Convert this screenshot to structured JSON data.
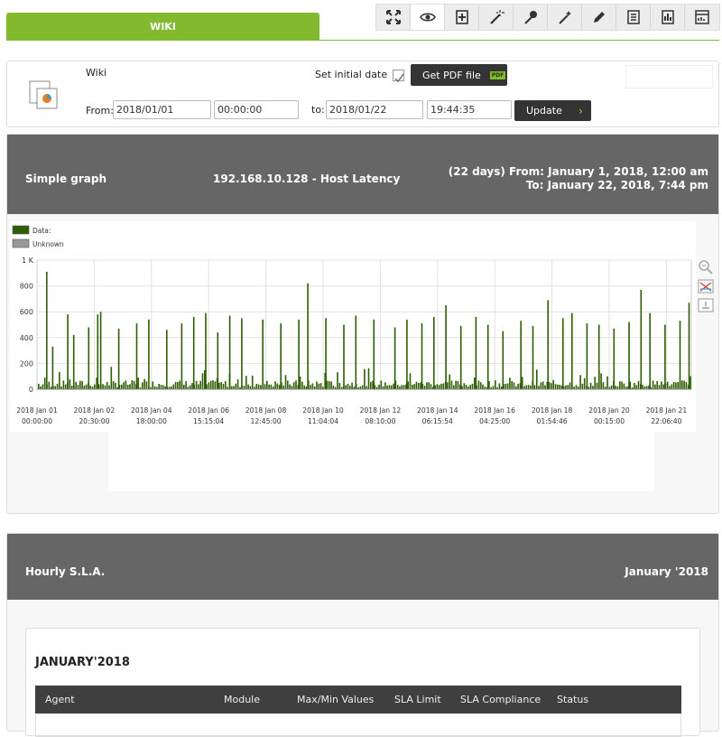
{
  "tab": {
    "label": "WIKI"
  },
  "toolbar": {
    "buttons": [
      "fullscreen-icon",
      "eye-icon",
      "add-item-icon",
      "wand-icon",
      "pin-icon",
      "magic-wand-icon",
      "pencil-icon",
      "list-icon",
      "bar-chart-icon",
      "report-icon"
    ],
    "active": "eye-icon"
  },
  "form": {
    "name": "Wiki",
    "set_initial_date_label": "Set initial date",
    "set_initial_date_checked": true,
    "pdf_button": "Get PDF file",
    "pdf_badge": "PDF",
    "from_label": "From:",
    "from_date": "2018/01/01",
    "from_time": "00:00:00",
    "to_label": "to:",
    "to_date": "2018/01/22",
    "to_time": "19:44:35",
    "update_button": "Update"
  },
  "graph_panel": {
    "left_title": "Simple graph",
    "center_title": "192.168.10.128 - Host Latency",
    "range_line1": "(22 days) From: January 1, 2018, 12:00 am",
    "range_line2": "To: January 22, 2018, 7:44 pm"
  },
  "colors": {
    "accent": "#82b92e",
    "data_series": "#2d5e00",
    "header_bg": "#666666"
  },
  "chart_data": {
    "type": "bar",
    "legend": [
      "Data:",
      "Unknown"
    ],
    "legend_colors": [
      "#2d5e00",
      "#999999"
    ],
    "y_ticks": [
      "1 K",
      "800",
      "600",
      "400",
      "200",
      "0"
    ],
    "ylim": [
      0,
      1000
    ],
    "x_ticks": [
      [
        "2018 Jan 01",
        "00:00:00"
      ],
      [
        "2018 Jan 02",
        "20:30:00"
      ],
      [
        "2018 Jan 04",
        "18:00:00"
      ],
      [
        "2018 Jan 06",
        "15:15:04"
      ],
      [
        "2018 Jan 08",
        "12:45:00"
      ],
      [
        "2018 Jan 10",
        "11:04:04"
      ],
      [
        "2018 Jan 12",
        "08:10:00"
      ],
      [
        "2018 Jan 14",
        "06:15:54"
      ],
      [
        "2018 Jan 16",
        "04:25:00"
      ],
      [
        "2018 Jan 18",
        "01:54:46"
      ],
      [
        "2018 Jan 20",
        "00:15:00"
      ],
      [
        "2018 Jan 21",
        "22:06:40"
      ]
    ],
    "spike_values": [
      {
        "day": 0.3,
        "v": 910
      },
      {
        "day": 0.5,
        "v": 330
      },
      {
        "day": 1.0,
        "v": 580
      },
      {
        "day": 1.2,
        "v": 420
      },
      {
        "day": 1.7,
        "v": 480
      },
      {
        "day": 2.0,
        "v": 580
      },
      {
        "day": 2.1,
        "v": 600
      },
      {
        "day": 2.7,
        "v": 470
      },
      {
        "day": 3.3,
        "v": 510
      },
      {
        "day": 3.7,
        "v": 540
      },
      {
        "day": 4.3,
        "v": 460
      },
      {
        "day": 4.8,
        "v": 510
      },
      {
        "day": 5.2,
        "v": 560
      },
      {
        "day": 5.6,
        "v": 590
      },
      {
        "day": 6.0,
        "v": 440
      },
      {
        "day": 6.4,
        "v": 570
      },
      {
        "day": 6.8,
        "v": 550
      },
      {
        "day": 7.5,
        "v": 540
      },
      {
        "day": 8.1,
        "v": 510
      },
      {
        "day": 8.7,
        "v": 540
      },
      {
        "day": 9.0,
        "v": 820
      },
      {
        "day": 9.6,
        "v": 550
      },
      {
        "day": 10.2,
        "v": 500
      },
      {
        "day": 10.6,
        "v": 570
      },
      {
        "day": 11.2,
        "v": 540
      },
      {
        "day": 11.9,
        "v": 480
      },
      {
        "day": 12.3,
        "v": 540
      },
      {
        "day": 12.8,
        "v": 510
      },
      {
        "day": 13.2,
        "v": 560
      },
      {
        "day": 13.6,
        "v": 650
      },
      {
        "day": 14.1,
        "v": 490
      },
      {
        "day": 14.6,
        "v": 560
      },
      {
        "day": 15.0,
        "v": 500
      },
      {
        "day": 15.5,
        "v": 450
      },
      {
        "day": 16.1,
        "v": 530
      },
      {
        "day": 16.5,
        "v": 490
      },
      {
        "day": 17.0,
        "v": 690
      },
      {
        "day": 17.5,
        "v": 550
      },
      {
        "day": 17.8,
        "v": 590
      },
      {
        "day": 18.3,
        "v": 510
      },
      {
        "day": 18.7,
        "v": 500
      },
      {
        "day": 19.2,
        "v": 470
      },
      {
        "day": 19.7,
        "v": 520
      },
      {
        "day": 20.1,
        "v": 770
      },
      {
        "day": 20.4,
        "v": 590
      },
      {
        "day": 20.9,
        "v": 500
      },
      {
        "day": 21.4,
        "v": 530
      },
      {
        "day": 21.7,
        "v": 670
      }
    ]
  },
  "sla_panel": {
    "title": "Hourly S.L.A.",
    "month_label": "January '2018",
    "section_title": "JANUARY'2018",
    "columns": [
      "Agent",
      "Module",
      "Max/Min Values",
      "SLA Limit",
      "SLA Compliance",
      "Status"
    ]
  }
}
